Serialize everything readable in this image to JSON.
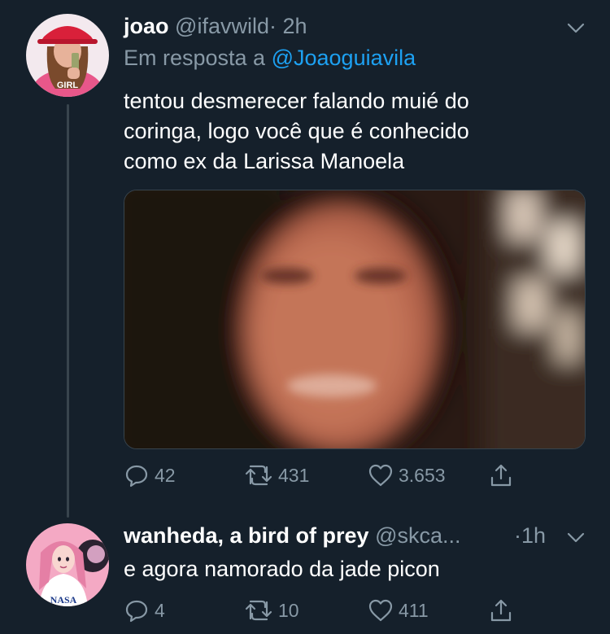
{
  "tweets": [
    {
      "name": "joao",
      "handle": "@ifavwild",
      "dot": "·",
      "time": "2h",
      "reply_prefix": "Em resposta a",
      "reply_mention": "@Joaoguiavila",
      "text_lines": [
        "tentou desmerecer falando muié do",
        "coringa, logo você que é conhecido",
        "como ex da Larissa Manoela"
      ],
      "avatar_icon": "profile-photo-red-hat",
      "avatar_badge": "GIRL",
      "counts": {
        "replies": "42",
        "retweets": "431",
        "likes": "3.653"
      }
    },
    {
      "name": "wanheda, a bird of prey",
      "handle": "@skca...",
      "dot": "·",
      "time": "1h",
      "text": "e agora namorado da jade picon",
      "avatar_icon": "profile-illustration-pink",
      "avatar_badge": "NASA",
      "counts": {
        "replies": "4",
        "retweets": "10",
        "likes": "411"
      }
    }
  ],
  "colors": {
    "background": "#15202b",
    "secondary_text": "#8899a6",
    "link": "#1da1f2",
    "divider": "#38444d"
  }
}
